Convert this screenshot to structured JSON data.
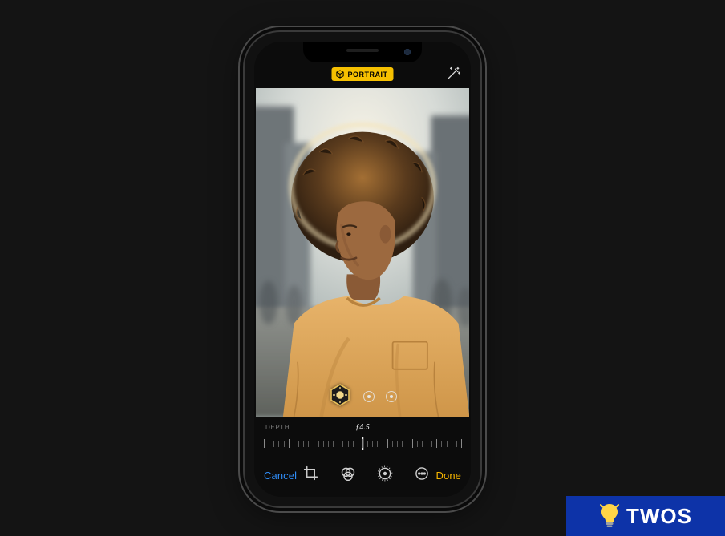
{
  "topbar": {
    "mode_badge": "PORTRAIT"
  },
  "depth": {
    "label": "DEPTH",
    "aperture_display": "ƒ4.5"
  },
  "toolbar": {
    "cancel": "Cancel",
    "done": "Done"
  },
  "icons": {
    "portrait_cube": "cube-icon",
    "wand": "magic-wand-icon",
    "lighting_hex": "portrait-lighting-hexagon-icon",
    "lighting_option": "lighting-option-dot",
    "crop": "crop-rotate-icon",
    "filters": "filters-icon",
    "adjust": "adjust-dial-icon",
    "more": "more-ellipsis-icon"
  },
  "colors": {
    "badge_bg": "#f6c000",
    "cancel_text": "#2f8cf6",
    "done_text": "#f6b500"
  },
  "watermark": {
    "text": "TWOS"
  }
}
